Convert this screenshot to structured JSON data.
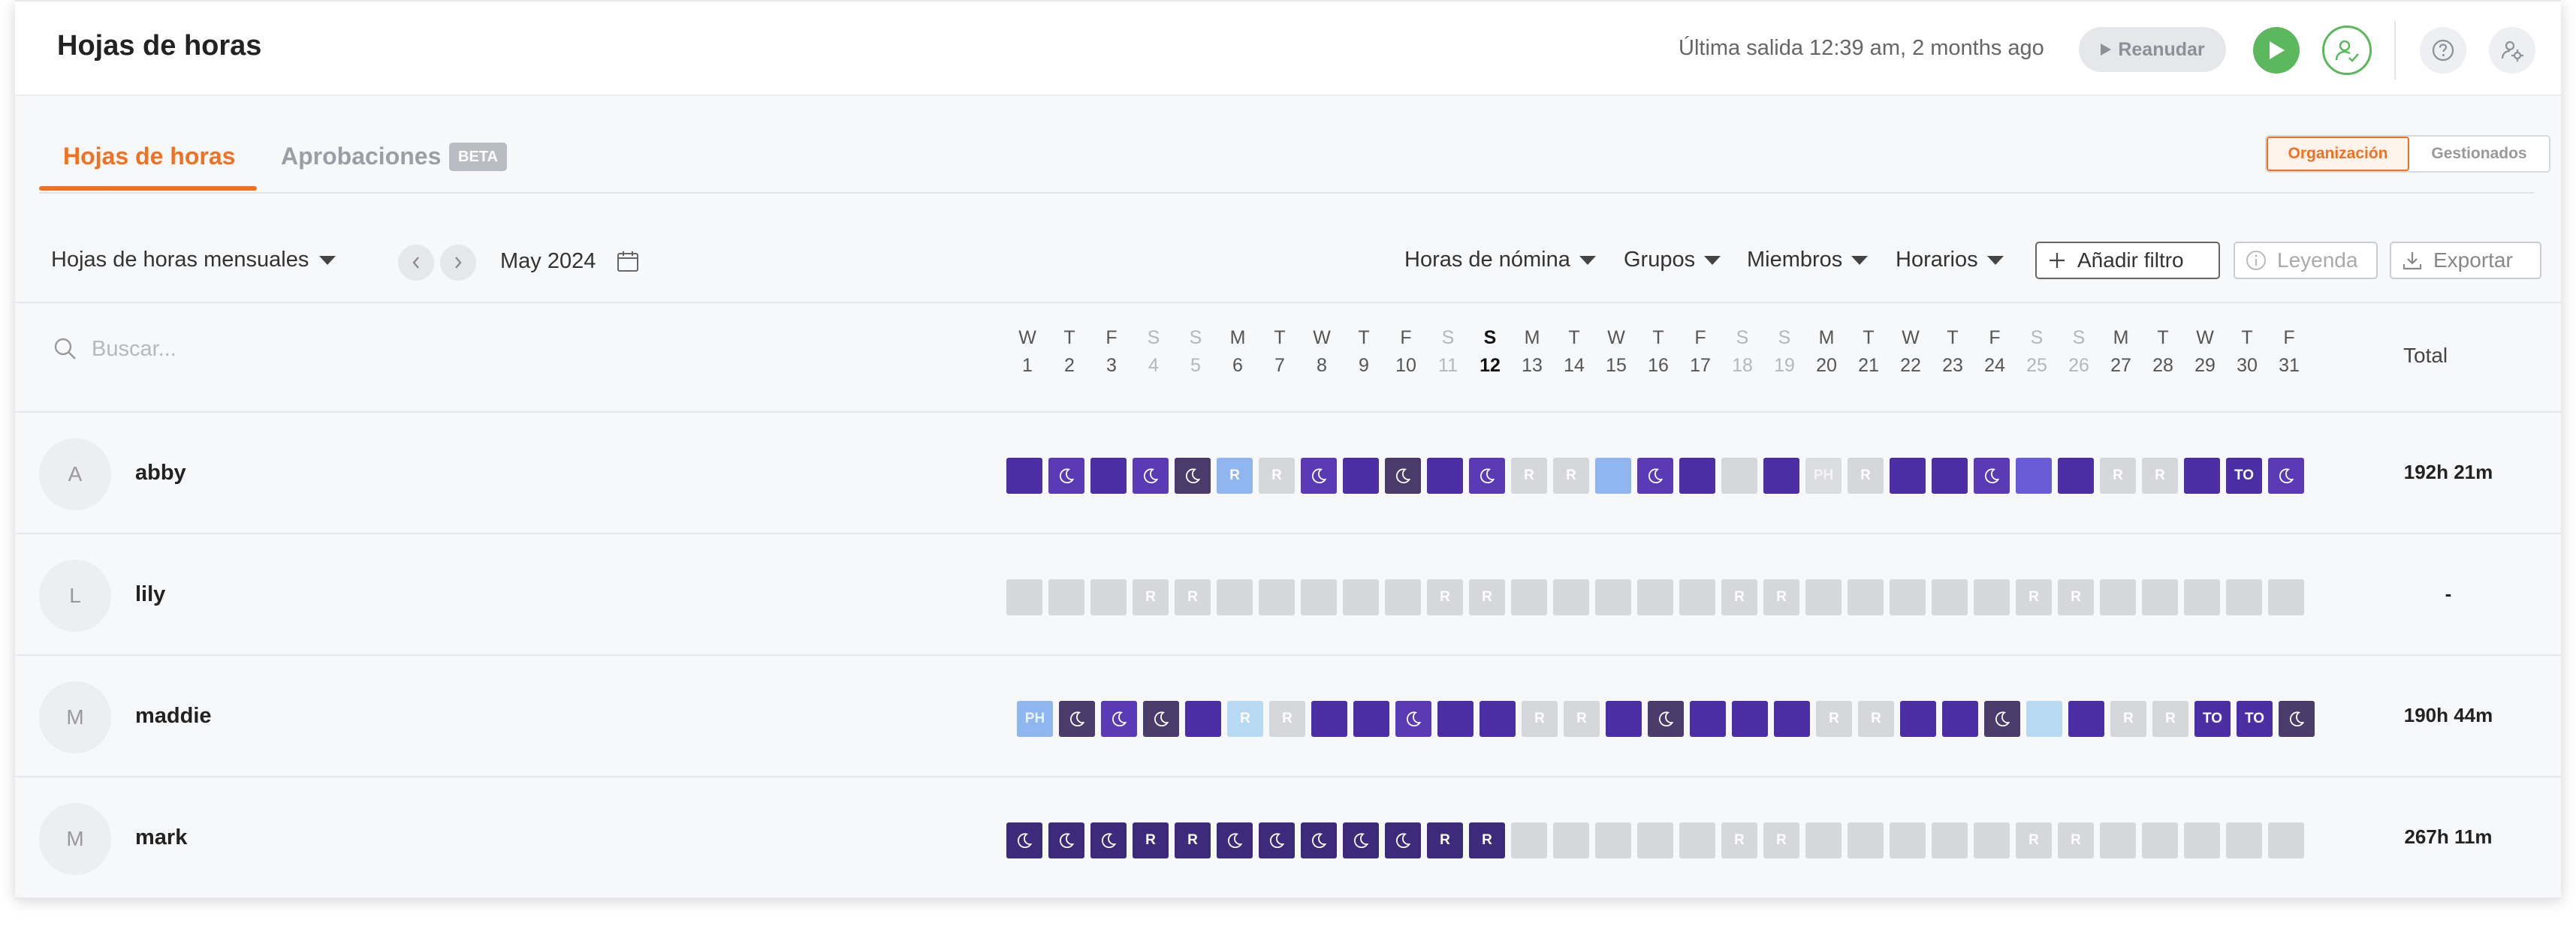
{
  "header": {
    "title": "Hojas de horas",
    "last_out": "Última salida 12:39 am, 2 months ago",
    "resume_label": "Reanudar"
  },
  "tabs": [
    {
      "label": "Hojas de horas",
      "active": true
    },
    {
      "label": "Aprobaciones",
      "badge": "BETA",
      "active": false
    }
  ],
  "view_toggle": {
    "options": [
      "Organización",
      "Gestionados"
    ],
    "selected": "Organización"
  },
  "toolbar": {
    "timesheet_type": "Hojas de horas mensuales",
    "period": "May 2024",
    "filters": [
      "Horas de nómina",
      "Grupos",
      "Miembros",
      "Horarios"
    ],
    "add_filter": "Añadir filtro",
    "legend": "Leyenda",
    "export": "Exportar"
  },
  "table": {
    "search_placeholder": "Buscar...",
    "total_header": "Total",
    "days": [
      {
        "dow": "W",
        "num": "1",
        "weekend": false
      },
      {
        "dow": "T",
        "num": "2",
        "weekend": false
      },
      {
        "dow": "F",
        "num": "3",
        "weekend": false
      },
      {
        "dow": "S",
        "num": "4",
        "weekend": true
      },
      {
        "dow": "S",
        "num": "5",
        "weekend": true
      },
      {
        "dow": "M",
        "num": "6",
        "weekend": false
      },
      {
        "dow": "T",
        "num": "7",
        "weekend": false
      },
      {
        "dow": "W",
        "num": "8",
        "weekend": false
      },
      {
        "dow": "T",
        "num": "9",
        "weekend": false
      },
      {
        "dow": "F",
        "num": "10",
        "weekend": false
      },
      {
        "dow": "S",
        "num": "11",
        "weekend": true
      },
      {
        "dow": "S",
        "num": "12",
        "weekend": true,
        "today": true
      },
      {
        "dow": "M",
        "num": "13",
        "weekend": false
      },
      {
        "dow": "T",
        "num": "14",
        "weekend": false
      },
      {
        "dow": "W",
        "num": "15",
        "weekend": false
      },
      {
        "dow": "T",
        "num": "16",
        "weekend": false
      },
      {
        "dow": "F",
        "num": "17",
        "weekend": false
      },
      {
        "dow": "S",
        "num": "18",
        "weekend": true
      },
      {
        "dow": "S",
        "num": "19",
        "weekend": true
      },
      {
        "dow": "M",
        "num": "20",
        "weekend": false
      },
      {
        "dow": "T",
        "num": "21",
        "weekend": false
      },
      {
        "dow": "W",
        "num": "22",
        "weekend": false
      },
      {
        "dow": "T",
        "num": "23",
        "weekend": false
      },
      {
        "dow": "F",
        "num": "24",
        "weekend": false
      },
      {
        "dow": "S",
        "num": "25",
        "weekend": true
      },
      {
        "dow": "S",
        "num": "26",
        "weekend": true
      },
      {
        "dow": "M",
        "num": "27",
        "weekend": false
      },
      {
        "dow": "T",
        "num": "28",
        "weekend": false
      },
      {
        "dow": "W",
        "num": "29",
        "weekend": false
      },
      {
        "dow": "T",
        "num": "30",
        "weekend": false
      },
      {
        "dow": "F",
        "num": "31",
        "weekend": false
      }
    ],
    "rows": [
      {
        "initial": "A",
        "name": "abby",
        "total": "192h 21m",
        "cells": [
          "w",
          "n",
          "w",
          "n",
          "d",
          "lb:R",
          "r:R",
          "n",
          "w",
          "d",
          "w",
          "n",
          "r:R",
          "r:R",
          "lb",
          "n",
          "w",
          "r",
          "w",
          "ph:PH",
          "r:R",
          "w",
          "w",
          "n",
          "pm",
          "w",
          "r:R",
          "r:R",
          "w",
          "tn:TO",
          "n"
        ]
      },
      {
        "initial": "L",
        "name": "lily",
        "total": "-",
        "cells": [
          "r",
          "r",
          "r",
          "r:R",
          "r:R",
          "r",
          "r",
          "r",
          "r",
          "r",
          "r:R",
          "r:R",
          "r",
          "r",
          "r",
          "r",
          "r",
          "r:R",
          "r:R",
          "r",
          "r",
          "r",
          "r",
          "r",
          "r:R",
          "r:R",
          "r",
          "r",
          "r",
          "r",
          "r"
        ]
      },
      {
        "initial": "M",
        "name": "maddie",
        "total": "190h 44m",
        "cells": [
          "phb:PH",
          "d",
          "n",
          "d",
          "w",
          "sb:R",
          "r:R",
          "w",
          "w",
          "n",
          "w",
          "w",
          "r:R",
          "r:R",
          "w",
          "d",
          "w",
          "w",
          "w",
          "r:R",
          "r:R",
          "w",
          "w",
          "d",
          "sb",
          "w",
          "r:R",
          "r:R",
          "tn:TO",
          "tn:TO",
          "d"
        ]
      },
      {
        "initial": "M",
        "name": "mark",
        "total": "267h 11m",
        "cells": [
          "kn",
          "kn",
          "kn",
          "k:R",
          "k:R",
          "kn",
          "kn",
          "kn",
          "kn",
          "kn",
          "k:R",
          "k:R",
          "r",
          "r",
          "r",
          "r",
          "r",
          "r:R",
          "r:R",
          "r",
          "r",
          "r",
          "r",
          "r",
          "r:R",
          "r:R",
          "r",
          "r",
          "r",
          "r",
          "r"
        ]
      }
    ]
  },
  "colors": {
    "accent": "#f37021",
    "green": "#5cb85c",
    "work": "#4b2ea3",
    "night": "#5b3bb5",
    "dark": "#4a3b6b",
    "light_blue": "#8fb6ee"
  }
}
